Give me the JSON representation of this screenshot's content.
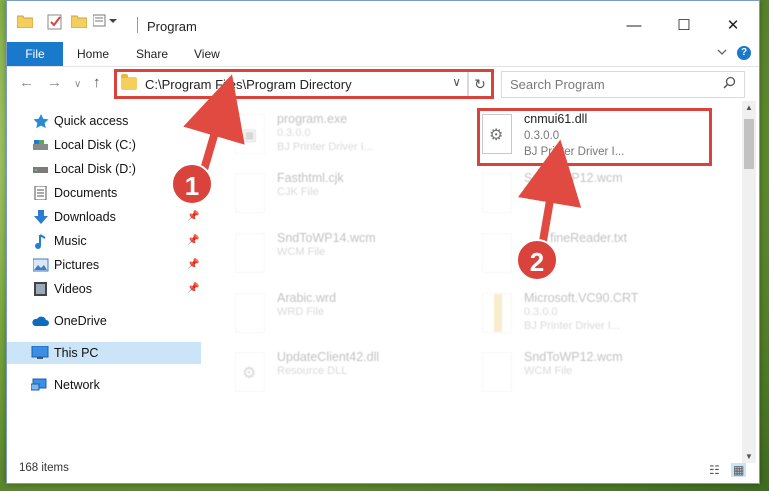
{
  "window": {
    "title": "Program",
    "controls": {
      "minimize": "—",
      "maximize": "☐",
      "close": "✕"
    }
  },
  "ribbon": {
    "tabs": [
      "File",
      "Home",
      "Share",
      "View"
    ],
    "expand_icon": "chevron-down-icon",
    "help_label": "?"
  },
  "nav": {
    "address": "C:\\Program Files\\Program Directory",
    "search_placeholder": "Search Program"
  },
  "sidebar": {
    "items": [
      {
        "label": "Quick access",
        "icon": "star-icon",
        "pinned": false
      },
      {
        "label": "Local Disk (C:)",
        "icon": "drive-icon",
        "pinned": false
      },
      {
        "label": "Local Disk (D:)",
        "icon": "drive-icon",
        "pinned": false
      },
      {
        "label": "Documents",
        "icon": "documents-icon",
        "pinned": false
      },
      {
        "label": "Downloads",
        "icon": "download-icon",
        "pinned": true
      },
      {
        "label": "Music",
        "icon": "music-icon",
        "pinned": true
      },
      {
        "label": "Pictures",
        "icon": "pictures-icon",
        "pinned": true
      },
      {
        "label": "Videos",
        "icon": "videos-icon",
        "pinned": true
      },
      {
        "label": "OneDrive",
        "icon": "cloud-icon",
        "pinned": false
      },
      {
        "label": "This PC",
        "icon": "computer-icon",
        "pinned": false,
        "selected": true
      },
      {
        "label": "Network",
        "icon": "network-icon",
        "pinned": false
      }
    ]
  },
  "files": [
    {
      "name": "program.exe",
      "line2": "0.3.0.0",
      "line3": "BJ Printer Driver I...",
      "highlighted": false
    },
    {
      "name": "cnmui61.dll",
      "line2": "0.3.0.0",
      "line3": "BJ Printer Driver I...",
      "highlighted": true
    },
    {
      "name": "Fasthtml.cjk",
      "line2": "CJK File",
      "line3": "",
      "highlighted": false
    },
    {
      "name": "SndToWP12.wcm",
      "line2": "WCM File",
      "line3": "",
      "highlighted": false
    },
    {
      "name": "SndToWP14.wcm",
      "line2": "WCM File",
      "line3": "",
      "highlighted": false
    },
    {
      "name": "fineReader.txt",
      "line2": "",
      "line3": "",
      "highlighted": false
    },
    {
      "name": "Arabic.wrd",
      "line2": "WRD File",
      "line3": "",
      "highlighted": false
    },
    {
      "name": "Microsoft.VC90.CRT",
      "line2": "0.3.0.0",
      "line3": "BJ Printer Driver I...",
      "highlighted": false
    },
    {
      "name": "UpdateClient42.dll",
      "line2": "Resource DLL",
      "line3": "",
      "highlighted": false
    },
    {
      "name": "SndToWP12.wcm",
      "line2": "WCM File",
      "line3": "",
      "highlighted": false
    }
  ],
  "status": {
    "item_count": "168 items"
  },
  "badges": [
    "1",
    "2"
  ],
  "colors": {
    "accent": "#1979ca",
    "highlight": "#d9433b",
    "selected_bg": "#cce4f7"
  }
}
